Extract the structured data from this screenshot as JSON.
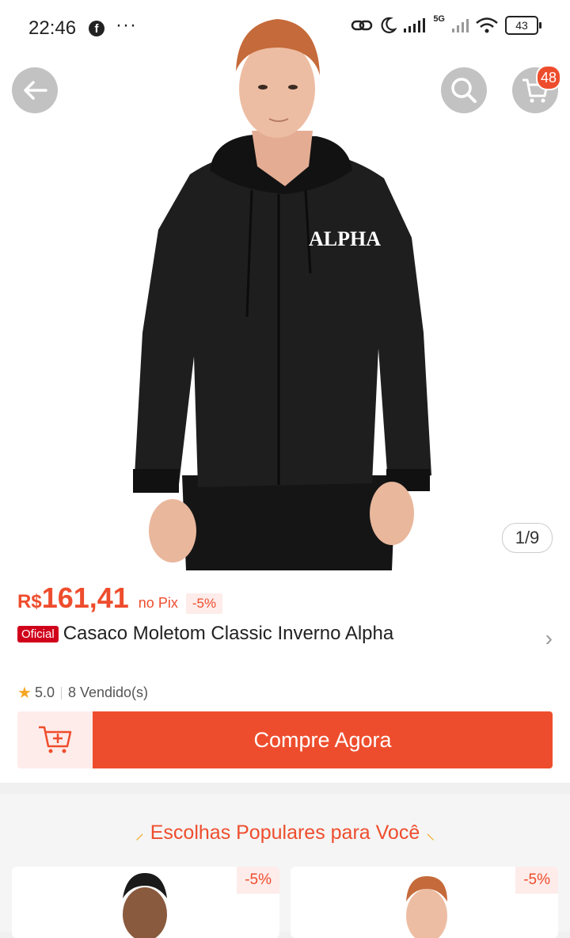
{
  "status_bar": {
    "time": "22:46",
    "dots": "···",
    "network": "5G",
    "battery": "43"
  },
  "hero": {
    "image_counter": "1/9",
    "cart_badge": "48",
    "brand_print": "ALPHA"
  },
  "product": {
    "currency": "R$",
    "price": "161,41",
    "payment_note": "no Pix",
    "discount": "-5%",
    "official_tag": "Oficial",
    "title": "Casaco Moletom Classic Inverno Alpha",
    "rating": "5.0",
    "sold": "8 Vendido(s)"
  },
  "actions": {
    "buy_now": "Compre Agora"
  },
  "popular": {
    "title": "Escolhas Populares para Você",
    "cards": [
      {
        "discount": "-5%"
      },
      {
        "discount": "-5%"
      }
    ]
  },
  "colors": {
    "accent": "#ee4d2d",
    "official": "#d0011b",
    "star": "#f5a623"
  }
}
